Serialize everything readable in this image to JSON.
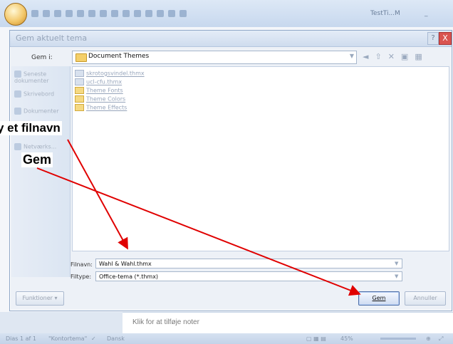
{
  "background_title_partial": "[ ]",
  "app": {
    "title_partial": "TestTi...M",
    "minimize_partial": "_"
  },
  "dialog": {
    "title": "Gem aktuelt tema",
    "help": "?",
    "close": "X",
    "save_in_label": "Gem i:",
    "save_in_value": "Document Themes",
    "places": [
      "Seneste dokumenter",
      "Skrivebord",
      "Dokumenter",
      "Netværks..."
    ],
    "files": [
      {
        "name": "skrotogsvindel.thmx",
        "type": "file"
      },
      {
        "name": "ucl-cfu.thmx",
        "type": "file"
      },
      {
        "name": "Theme Fonts",
        "type": "folder"
      },
      {
        "name": "Theme Colors",
        "type": "folder"
      },
      {
        "name": "Theme Effects",
        "type": "folder"
      }
    ],
    "filename_label": "Filnavn:",
    "filename_value": "Wahl & Wahl.thmx",
    "filetype_label": "Filtype:",
    "filetype_value": "Office-tema (*.thmx)",
    "tools_button": "Funktioner",
    "save_button": "Gem",
    "cancel_button": "Annuller"
  },
  "notes": {
    "placeholder": "Klik for at tilføje noter"
  },
  "status_bar": {
    "slide_info": "Dias 1 af 1",
    "theme": "\"Kontortema\"",
    "language": "Dansk",
    "zoom": "45%"
  },
  "annotations": {
    "filename_hint": "y et filnavn",
    "save_hint": "Gem",
    "arrow_color": "#e00000"
  }
}
